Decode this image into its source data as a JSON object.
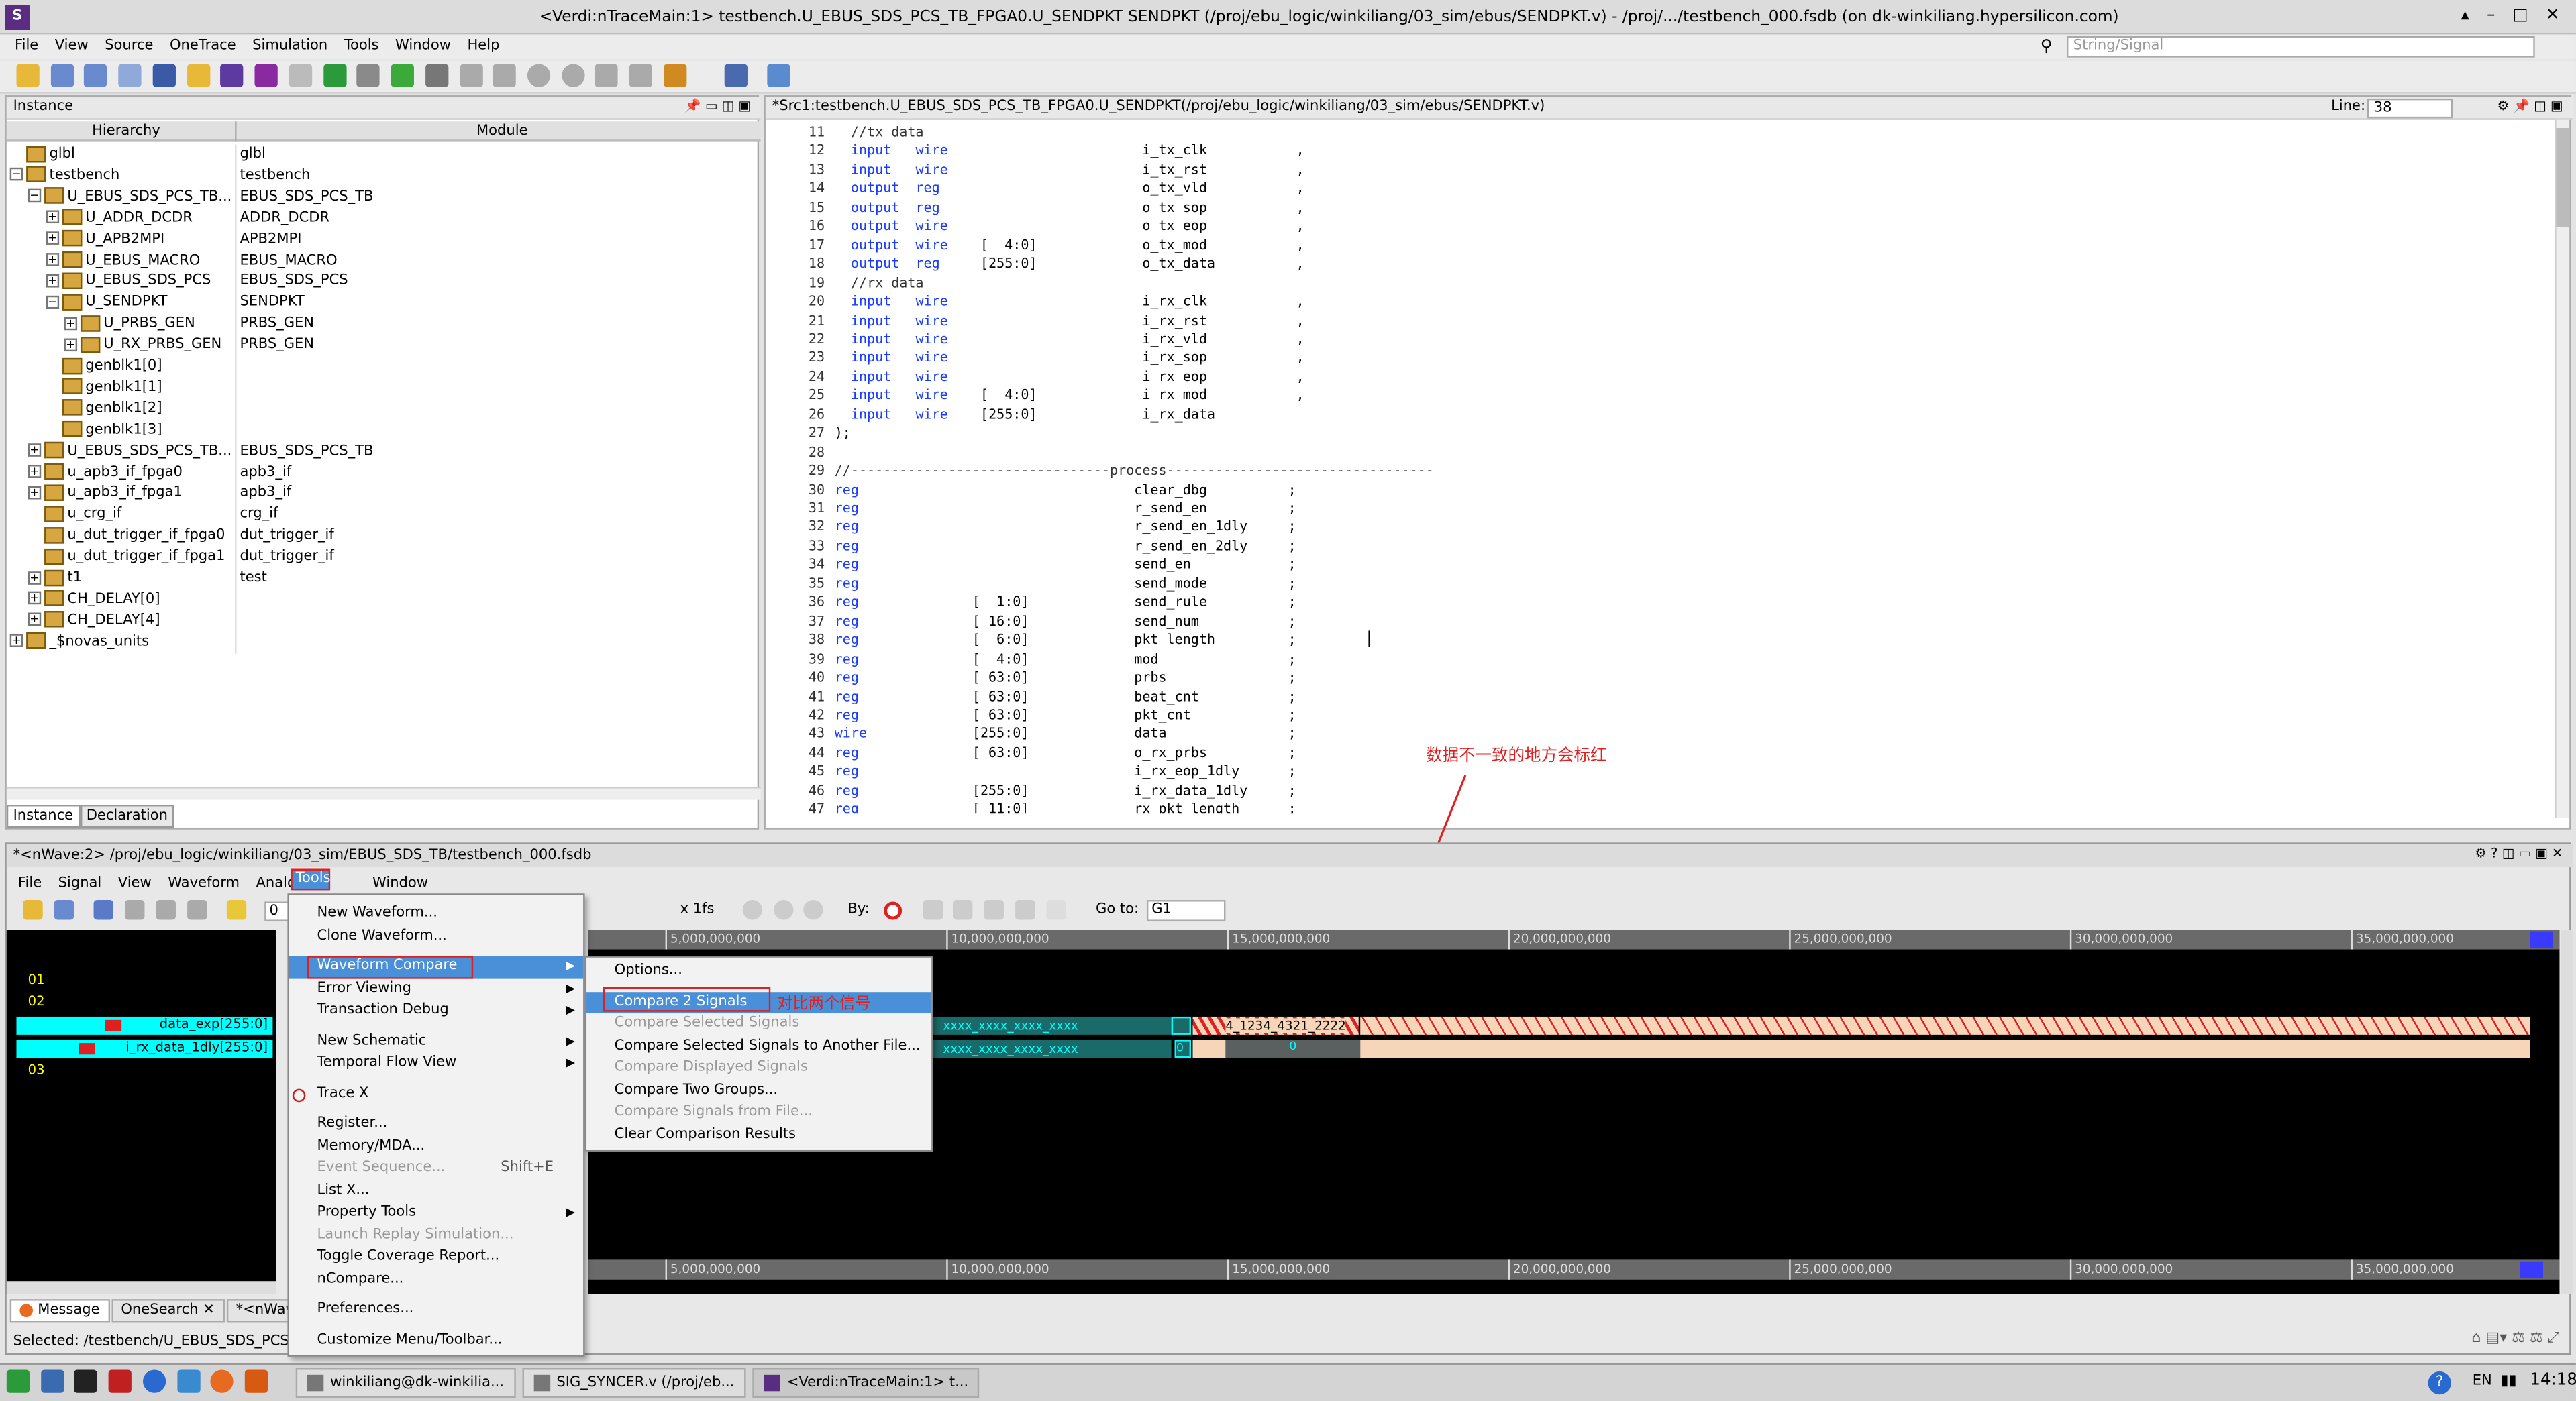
{
  "window": {
    "title": "<Verdi:nTraceMain:1> testbench.U_EBUS_SDS_PCS_TB_FPGA0.U_SENDPKT SENDPKT (/proj/ebu_logic/winkiliang/03_sim/ebus/SENDPKT.v) - /proj/.../testbench_000.fsdb (on dk-winkiliang.hypersilicon.com)",
    "controls": [
      "▴",
      "–",
      "□",
      "✕"
    ]
  },
  "menubar": [
    "File",
    "View",
    "Source",
    "OneTrace",
    "Simulation",
    "Tools",
    "Window",
    "Help"
  ],
  "search": {
    "placeholder": "String/Signal"
  },
  "instance_panel": {
    "title": "Instance",
    "col_hier": "Hierarchy",
    "col_module": "Module",
    "rows": [
      {
        "name": "glbl",
        "module": "glbl",
        "indent": 0,
        "exp": ""
      },
      {
        "name": "testbench",
        "module": "testbench",
        "indent": 0,
        "exp": "−"
      },
      {
        "name": "U_EBUS_SDS_PCS_TB...",
        "module": "EBUS_SDS_PCS_TB",
        "indent": 1,
        "exp": "−"
      },
      {
        "name": "U_ADDR_DCDR",
        "module": "ADDR_DCDR",
        "indent": 2,
        "exp": "+"
      },
      {
        "name": "U_APB2MPI",
        "module": "APB2MPI",
        "indent": 2,
        "exp": "+"
      },
      {
        "name": "U_EBUS_MACRO",
        "module": "EBUS_MACRO",
        "indent": 2,
        "exp": "+"
      },
      {
        "name": "U_EBUS_SDS_PCS",
        "module": "EBUS_SDS_PCS",
        "indent": 2,
        "exp": "+"
      },
      {
        "name": "U_SENDPKT",
        "module": "SENDPKT",
        "indent": 2,
        "exp": "−"
      },
      {
        "name": "U_PRBS_GEN",
        "module": "PRBS_GEN",
        "indent": 3,
        "exp": "+"
      },
      {
        "name": "U_RX_PRBS_GEN",
        "module": "PRBS_GEN",
        "indent": 3,
        "exp": "+"
      },
      {
        "name": "genblk1[0]",
        "module": "",
        "indent": 2,
        "exp": ""
      },
      {
        "name": "genblk1[1]",
        "module": "",
        "indent": 2,
        "exp": ""
      },
      {
        "name": "genblk1[2]",
        "module": "",
        "indent": 2,
        "exp": ""
      },
      {
        "name": "genblk1[3]",
        "module": "",
        "indent": 2,
        "exp": ""
      },
      {
        "name": "U_EBUS_SDS_PCS_TB...",
        "module": "EBUS_SDS_PCS_TB",
        "indent": 1,
        "exp": "+"
      },
      {
        "name": "u_apb3_if_fpga0",
        "module": "apb3_if",
        "indent": 1,
        "exp": "+"
      },
      {
        "name": "u_apb3_if_fpga1",
        "module": "apb3_if",
        "indent": 1,
        "exp": "+"
      },
      {
        "name": "u_crg_if",
        "module": "crg_if",
        "indent": 1,
        "exp": ""
      },
      {
        "name": "u_dut_trigger_if_fpga0",
        "module": "dut_trigger_if",
        "indent": 1,
        "exp": ""
      },
      {
        "name": "u_dut_trigger_if_fpga1",
        "module": "dut_trigger_if",
        "indent": 1,
        "exp": ""
      },
      {
        "name": "t1",
        "module": "test",
        "indent": 1,
        "exp": "+"
      },
      {
        "name": "CH_DELAY[0]",
        "module": "",
        "indent": 1,
        "exp": "+"
      },
      {
        "name": "CH_DELAY[4]",
        "module": "",
        "indent": 1,
        "exp": "+"
      },
      {
        "name": "_$novas_units",
        "module": "",
        "indent": 0,
        "exp": "+"
      }
    ],
    "tabs": [
      "Instance",
      "Declaration"
    ]
  },
  "source_panel": {
    "title": "*Src1:testbench.U_EBUS_SDS_PCS_TB_FPGA0.U_SENDPKT(/proj/ebu_logic/winkiliang/03_sim/ebus/SENDPKT.v)",
    "line_label": "Line:",
    "line_value": "38",
    "lines": [
      {
        "n": "11",
        "t": "  //tx data"
      },
      {
        "n": "12",
        "t": "  input   wire                        i_tx_clk           ,"
      },
      {
        "n": "13",
        "t": "  input   wire                        i_tx_rst           ,"
      },
      {
        "n": "14",
        "t": "  output  reg                         o_tx_vld           ,"
      },
      {
        "n": "15",
        "t": "  output  reg                         o_tx_sop           ,"
      },
      {
        "n": "16",
        "t": "  output  wire                        o_tx_eop           ,"
      },
      {
        "n": "17",
        "t": "  output  wire    [  4:0]             o_tx_mod           ,"
      },
      {
        "n": "18",
        "t": "  output  reg     [255:0]             o_tx_data          ,"
      },
      {
        "n": "19",
        "t": "  //rx data"
      },
      {
        "n": "20",
        "t": "  input   wire                        i_rx_clk           ,"
      },
      {
        "n": "21",
        "t": "  input   wire                        i_rx_rst           ,"
      },
      {
        "n": "22",
        "t": "  input   wire                        i_rx_vld           ,"
      },
      {
        "n": "23",
        "t": "  input   wire                        i_rx_sop           ,"
      },
      {
        "n": "24",
        "t": "  input   wire                        i_rx_eop           ,"
      },
      {
        "n": "25",
        "t": "  input   wire    [  4:0]             i_rx_mod           ,"
      },
      {
        "n": "26",
        "t": "  input   wire    [255:0]             i_rx_data"
      },
      {
        "n": "27",
        "t": ");"
      },
      {
        "n": "28",
        "t": ""
      },
      {
        "n": "29",
        "t": "//--------------------------------process---------------------------------"
      },
      {
        "n": "30",
        "t": "reg                                  clear_dbg          ;"
      },
      {
        "n": "31",
        "t": "reg                                  r_send_en          ;"
      },
      {
        "n": "32",
        "t": "reg                                  r_send_en_1dly     ;"
      },
      {
        "n": "33",
        "t": "reg                                  r_send_en_2dly     ;"
      },
      {
        "n": "34",
        "t": "reg                                  send_en            ;"
      },
      {
        "n": "35",
        "t": "reg                                  send_mode          ;"
      },
      {
        "n": "36",
        "t": "reg              [  1:0]             send_rule          ;"
      },
      {
        "n": "37",
        "t": "reg              [ 16:0]             send_num           ;"
      },
      {
        "n": "38",
        "t": "reg              [  6:0]             pkt_length         ;"
      },
      {
        "n": "39",
        "t": "reg              [  4:0]             mod                ;"
      },
      {
        "n": "40",
        "t": "reg              [ 63:0]             prbs               ;"
      },
      {
        "n": "41",
        "t": "reg              [ 63:0]             beat_cnt           ;"
      },
      {
        "n": "42",
        "t": "reg              [ 63:0]             pkt_cnt            ;"
      },
      {
        "n": "43",
        "t": "wire             [255:0]             data               ;"
      },
      {
        "n": "44",
        "t": "reg              [ 63:0]             o_rx_prbs          ;"
      },
      {
        "n": "45",
        "t": "reg                                  i_rx_eop_1dly      ;"
      },
      {
        "n": "46",
        "t": "reg              [255:0]             i_rx_data_1dly     ;"
      },
      {
        "n": "47",
        "t": "reg              [ 11:0]             rx_pkt_length      ;"
      }
    ]
  },
  "annotation_red": "数据不一致的地方会标红",
  "annotation_blue": "对比两个信号",
  "nwave": {
    "title": "*<nWave:2> /proj/ebu_logic/winkiliang/03_sim/EBUS_SDS_TB/testbench_000.fsdb",
    "menubar": [
      "File",
      "Signal",
      "View",
      "Waveform",
      "Analog",
      "Tools",
      "Window"
    ],
    "zoom_label": "x 1fs",
    "by_label": "By:",
    "goto_label": "Go to:",
    "goto_value": "G1",
    "cursor_value": "0",
    "groups": [
      "01",
      "02",
      "03"
    ],
    "signals": [
      "data_exp[255:0]",
      "i_rx_data_1dly[255:0]"
    ],
    "ruler": [
      "5,000,000,000",
      "10,000,000,000",
      "15,000,000,000",
      "20,000,000,000",
      "25,000,000,000",
      "30,000,000,000",
      "35,000,000,000"
    ],
    "wave_text_a": "xxxx_xxxx_xxxx_xxxx",
    "wave_text_b": "xxxx_xxxx_xxxx_xxxx",
    "wave_val_zero": "0",
    "wave_val_a2": "4_1234_4321_2222",
    "tabs": [
      "Message",
      "OneSearch",
      "*<nWave:2"
    ],
    "status": "Selected: /testbench/U_EBUS_SDS_PCS_T"
  },
  "tools_menu": [
    {
      "label": "New Waveform...",
      "type": "item"
    },
    {
      "label": "Clone Waveform...",
      "type": "item"
    },
    {
      "type": "sep"
    },
    {
      "label": "Waveform Compare",
      "type": "sub",
      "hl": true
    },
    {
      "label": "Error Viewing",
      "type": "sub"
    },
    {
      "label": "Transaction Debug",
      "type": "sub"
    },
    {
      "type": "sep"
    },
    {
      "label": "New Schematic",
      "type": "sub"
    },
    {
      "label": "Temporal Flow View",
      "type": "sub"
    },
    {
      "type": "sep"
    },
    {
      "label": "Trace X",
      "type": "item"
    },
    {
      "type": "sep"
    },
    {
      "label": "Register...",
      "type": "item"
    },
    {
      "label": "Memory/MDA...",
      "type": "item"
    },
    {
      "label": "Event Sequence...",
      "type": "dis",
      "shortcut": "Shift+E"
    },
    {
      "label": "List X...",
      "type": "item"
    },
    {
      "label": "Property Tools",
      "type": "sub"
    },
    {
      "label": "Launch Replay Simulation...",
      "type": "dis"
    },
    {
      "label": "Toggle Coverage Report...",
      "type": "item"
    },
    {
      "label": "nCompare...",
      "type": "item"
    },
    {
      "type": "sep"
    },
    {
      "label": "Preferences...",
      "type": "item"
    },
    {
      "type": "sep"
    },
    {
      "label": "Customize Menu/Toolbar...",
      "type": "item"
    }
  ],
  "compare_menu": [
    {
      "label": "Options...",
      "type": "item"
    },
    {
      "type": "sep"
    },
    {
      "label": "Compare 2 Signals",
      "type": "item",
      "hl": true
    },
    {
      "label": "Compare Selected Signals",
      "type": "dis"
    },
    {
      "label": "Compare Selected Signals to Another File...",
      "type": "item"
    },
    {
      "label": "Compare Displayed Signals",
      "type": "dis"
    },
    {
      "label": "Compare Two Groups...",
      "type": "item"
    },
    {
      "label": "Compare Signals from File...",
      "type": "dis"
    },
    {
      "label": "Clear Comparison Results",
      "type": "item"
    }
  ],
  "taskbar": {
    "items": [
      "winkiliang@dk-winkilia...",
      "SIG_SYNCER.v (/proj/eb...",
      "<Verdi:nTraceMain:1> t..."
    ],
    "lang": "EN",
    "clock": "14:18"
  },
  "colors": {
    "accent": "#4a90d9",
    "red": "#e02020",
    "wave_bg": "#000000",
    "wave_ok": "#f7d5b8",
    "signal_hl": "#00ffff"
  }
}
